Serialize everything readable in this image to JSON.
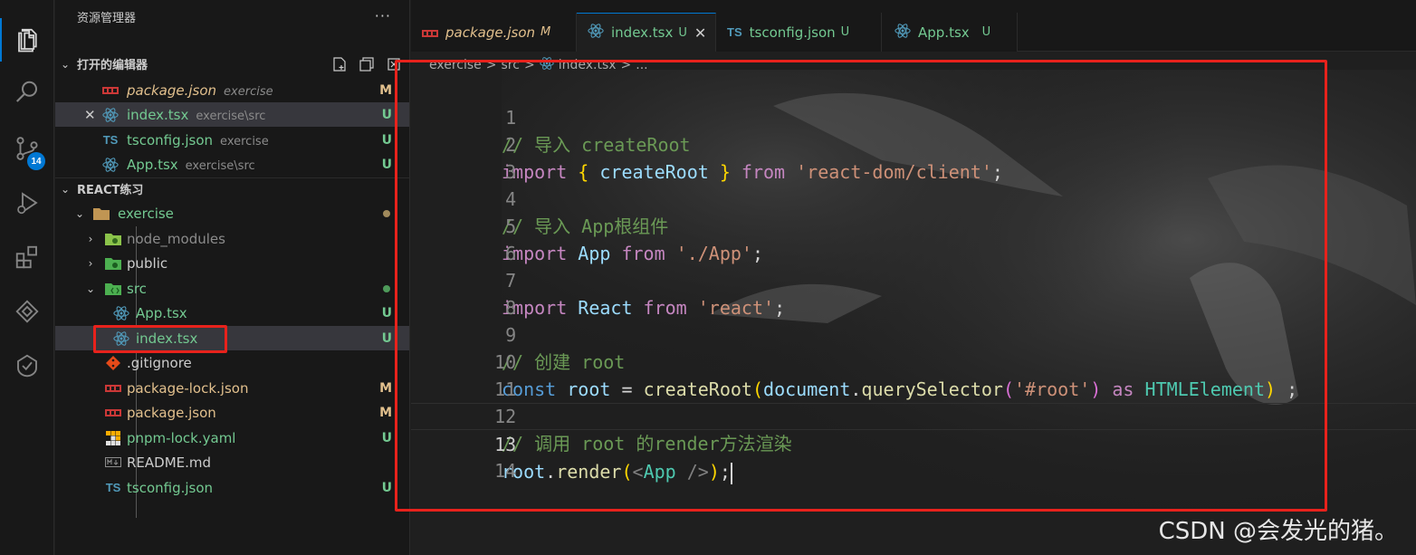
{
  "colors": {
    "accent": "#0078d4",
    "modified": "#e2c08d",
    "untracked": "#73c991",
    "highlight_box": "#e8221c"
  },
  "activity_bar": {
    "items": [
      {
        "icon": "explorer-icon"
      },
      {
        "icon": "search-icon"
      },
      {
        "icon": "source-control-icon",
        "badge": "14"
      },
      {
        "icon": "run-debug-icon"
      },
      {
        "icon": "extensions-icon"
      },
      {
        "icon": "remote-icon"
      },
      {
        "icon": "testing-icon"
      }
    ]
  },
  "sidebar": {
    "title": "资源管理器",
    "more": "···",
    "open_editors": {
      "title": "打开的编辑器",
      "items": [
        {
          "name": "package.json",
          "desc": "exercise",
          "status": "M",
          "icon": "npm-icon"
        },
        {
          "name": "index.tsx",
          "desc": "exercise\\src",
          "status": "U",
          "icon": "react-icon",
          "close": "✕"
        },
        {
          "name": "tsconfig.json",
          "desc": "exercise",
          "status": "U",
          "icon": "ts-icon"
        },
        {
          "name": "App.tsx",
          "desc": "exercise\\src",
          "status": "U",
          "icon": "react-icon"
        }
      ]
    },
    "workspace": {
      "title": "REACT练习",
      "items": [
        {
          "name": "exercise",
          "icon": "folder-icon"
        },
        {
          "name": "node_modules",
          "icon": "node-folder-icon"
        },
        {
          "name": "public",
          "icon": "public-folder-icon"
        },
        {
          "name": "src",
          "icon": "src-folder-icon"
        },
        {
          "name": "App.tsx",
          "status": "U",
          "icon": "react-icon"
        },
        {
          "name": "index.tsx",
          "status": "U",
          "icon": "react-icon"
        },
        {
          "name": ".gitignore",
          "icon": "git-icon"
        },
        {
          "name": "package-lock.json",
          "status": "M",
          "icon": "npm-icon"
        },
        {
          "name": "package.json",
          "status": "M",
          "icon": "npm-icon"
        },
        {
          "name": "pnpm-lock.yaml",
          "status": "U",
          "icon": "pnpm-icon"
        },
        {
          "name": "README.md",
          "icon": "markdown-icon"
        },
        {
          "name": "tsconfig.json",
          "status": "U",
          "icon": "ts-icon"
        }
      ]
    }
  },
  "tabs": [
    {
      "label": "package.json",
      "status": "M",
      "icon": "npm-icon"
    },
    {
      "label": "index.tsx",
      "status": "U",
      "close": "✕",
      "icon": "react-icon",
      "active": true
    },
    {
      "label": "tsconfig.json",
      "status": "U",
      "icon": "ts-icon"
    },
    {
      "label": "App.tsx",
      "status": "U",
      "icon": "react-icon"
    }
  ],
  "breadcrumb": {
    "parts": [
      "exercise",
      "src",
      "index.tsx",
      "..."
    ],
    "sep": ">"
  },
  "editor": {
    "current_line": "13",
    "line_numbers": [
      "1",
      "2",
      "3",
      "4",
      "5",
      "6",
      "7",
      "8",
      "9",
      "10",
      "11",
      "12",
      "13",
      "14"
    ],
    "lines": {
      "l1": [
        "// 导入 createRoot"
      ],
      "l2": [
        "import",
        " ",
        "{",
        " createRoot ",
        "}",
        " from ",
        "'react-dom/client'",
        ";"
      ],
      "l4": [
        "// 导入 App根组件"
      ],
      "l5": [
        "import",
        " App ",
        "from",
        " ",
        "'./App'",
        ";"
      ],
      "l7": [
        "import",
        " React ",
        "from",
        " ",
        "'react'",
        ";"
      ],
      "l9": [
        "// 创建 root"
      ],
      "l10": [
        "const",
        " ",
        "root",
        " = ",
        "createRoot",
        "(",
        "document",
        ".",
        "querySelector",
        "(",
        "'#root'",
        ")",
        " ",
        "as",
        " ",
        "HTMLElement",
        ")",
        " ;"
      ],
      "l12": [
        "// 调用 root 的render方法渲染"
      ],
      "l13": [
        "root",
        ".",
        "render",
        "(",
        "<",
        "App",
        " />",
        ")",
        ";"
      ]
    }
  },
  "watermark": "CSDN @会发光的猪。"
}
